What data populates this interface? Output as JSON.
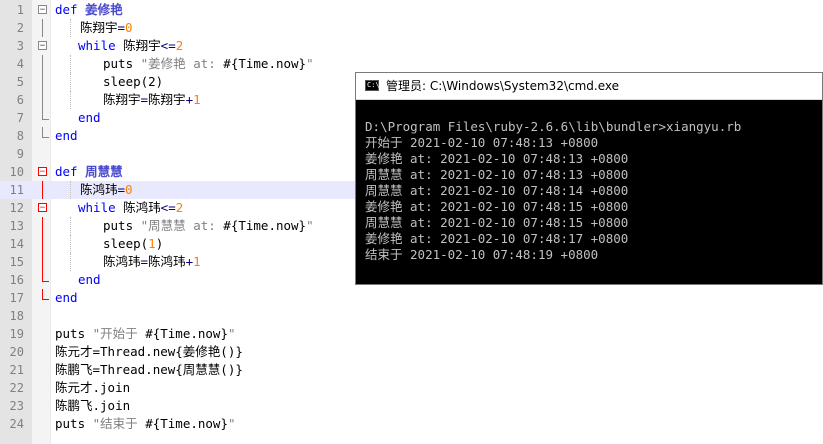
{
  "editor": {
    "lines": [
      {
        "n": "1",
        "parts": [
          [
            "kw",
            "def "
          ],
          [
            "fn",
            "姜修艳"
          ]
        ]
      },
      {
        "n": "2",
        "parts": [
          [
            "txt",
            "陈翔宇"
          ],
          [
            "op",
            "="
          ],
          [
            "num",
            "0"
          ]
        ]
      },
      {
        "n": "3",
        "parts": [
          [
            "kw",
            "while "
          ],
          [
            "txt",
            "陈翔宇"
          ],
          [
            "op",
            "<="
          ],
          [
            "num",
            "2"
          ]
        ]
      },
      {
        "n": "4",
        "parts": [
          [
            "txt",
            "puts "
          ],
          [
            "str",
            "\"姜修艳 at: "
          ],
          [
            "txt",
            "#{Time.now}"
          ],
          [
            "str",
            "\""
          ]
        ]
      },
      {
        "n": "5",
        "parts": [
          [
            "txt",
            "sleep(2)"
          ]
        ]
      },
      {
        "n": "6",
        "parts": [
          [
            "txt",
            "陈翔宇"
          ],
          [
            "op",
            "="
          ],
          [
            "txt",
            "陈翔宇"
          ],
          [
            "op",
            "+"
          ],
          [
            "num",
            "1"
          ]
        ]
      },
      {
        "n": "7",
        "parts": [
          [
            "kw",
            "end"
          ]
        ]
      },
      {
        "n": "8",
        "parts": [
          [
            "kw",
            "end"
          ]
        ]
      },
      {
        "n": "9",
        "parts": []
      },
      {
        "n": "10",
        "parts": [
          [
            "kw",
            "def "
          ],
          [
            "fn",
            "周慧慧"
          ]
        ]
      },
      {
        "n": "11",
        "parts": [
          [
            "txt",
            "陈鸿玮"
          ],
          [
            "op",
            "="
          ],
          [
            "num",
            "0"
          ]
        ]
      },
      {
        "n": "12",
        "parts": [
          [
            "kw",
            "while "
          ],
          [
            "txt",
            "陈鸿玮"
          ],
          [
            "op",
            "<="
          ],
          [
            "num",
            "2"
          ]
        ]
      },
      {
        "n": "13",
        "parts": [
          [
            "txt",
            "puts "
          ],
          [
            "str",
            "\"周慧慧 at: "
          ],
          [
            "txt",
            "#{Time.now}"
          ],
          [
            "str",
            "\""
          ]
        ]
      },
      {
        "n": "14",
        "parts": [
          [
            "txt",
            "sleep("
          ],
          [
            "num",
            "1"
          ],
          [
            "txt",
            ")"
          ]
        ]
      },
      {
        "n": "15",
        "parts": [
          [
            "txt",
            "陈鸿玮"
          ],
          [
            "op",
            "="
          ],
          [
            "txt",
            "陈鸿玮"
          ],
          [
            "op",
            "+"
          ],
          [
            "num",
            "1"
          ]
        ]
      },
      {
        "n": "16",
        "parts": [
          [
            "kw",
            "end"
          ]
        ]
      },
      {
        "n": "17",
        "parts": [
          [
            "kw",
            "end"
          ]
        ]
      },
      {
        "n": "18",
        "parts": []
      },
      {
        "n": "19",
        "parts": [
          [
            "txt",
            "puts "
          ],
          [
            "str",
            "\"开始于 "
          ],
          [
            "txt",
            "#{Time.now}"
          ],
          [
            "str",
            "\""
          ]
        ]
      },
      {
        "n": "20",
        "parts": [
          [
            "txt",
            "陈元才=Thread.new{姜修艳()}"
          ]
        ]
      },
      {
        "n": "21",
        "parts": [
          [
            "txt",
            "陈鹏飞=Thread.new{周慧慧()}"
          ]
        ]
      },
      {
        "n": "22",
        "parts": [
          [
            "txt",
            "陈元才.join"
          ]
        ]
      },
      {
        "n": "23",
        "parts": [
          [
            "txt",
            "陈鹏飞.join"
          ]
        ]
      },
      {
        "n": "24",
        "parts": [
          [
            "txt",
            "puts "
          ],
          [
            "str",
            "\"结束于 "
          ],
          [
            "txt",
            "#{Time.now}"
          ],
          [
            "str",
            "\""
          ]
        ]
      }
    ]
  },
  "cmd": {
    "title": "管理员: C:\\Windows\\System32\\cmd.exe",
    "icon_label": "C:\\",
    "output": [
      "",
      "D:\\Program Files\\ruby-2.6.6\\lib\\bundler>xiangyu.rb",
      "开始于 2021-02-10 07:48:13 +0800",
      "姜修艳 at: 2021-02-10 07:48:13 +0800",
      "周慧慧 at: 2021-02-10 07:48:13 +0800",
      "周慧慧 at: 2021-02-10 07:48:14 +0800",
      "姜修艳 at: 2021-02-10 07:48:15 +0800",
      "周慧慧 at: 2021-02-10 07:48:15 +0800",
      "姜修艳 at: 2021-02-10 07:48:17 +0800",
      "结束于 2021-02-10 07:48:19 +0800"
    ]
  }
}
